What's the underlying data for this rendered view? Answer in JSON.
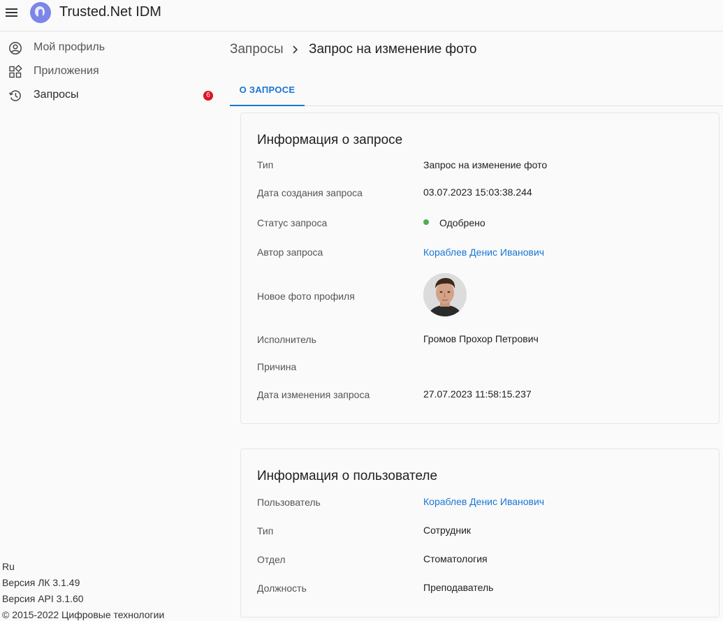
{
  "app": {
    "title": "Trusted.Net IDM"
  },
  "sidebar": {
    "items": [
      {
        "label": "Мой профиль",
        "icon": "account-circle-icon"
      },
      {
        "label": "Приложения",
        "icon": "apps-grid-icon"
      },
      {
        "label": "Запросы",
        "icon": "history-icon",
        "badge": "6"
      }
    ]
  },
  "footer": {
    "language": "Ru",
    "version_lk": "Версия ЛК 3.1.49",
    "version_api": "Версия API 3.1.60",
    "copyright": "© 2015-2022 Цифровые технологии"
  },
  "breadcrumb": {
    "root": "Запросы",
    "current": "Запрос на изменение фото"
  },
  "tabs": [
    {
      "label": "О ЗАПРОСЕ",
      "active": true
    }
  ],
  "request_info": {
    "title": "Информация о запросе",
    "rows": [
      {
        "label": "Тип",
        "value": "Запрос на изменение фото"
      },
      {
        "label": "Дата создания запроса",
        "value": "03.07.2023 15:03:38.244"
      },
      {
        "label": "Статус запроса",
        "value": "Одобрено",
        "status_color": "#4caf50"
      },
      {
        "label": "Автор запроса",
        "value": "Кораблев Денис Иванович"
      },
      {
        "label": "Новое фото профиля",
        "value": ""
      },
      {
        "label": "Исполнитель",
        "value": "Громов Прохор Петрович"
      },
      {
        "label": "Причина",
        "value": ""
      },
      {
        "label": "Дата изменения запроса",
        "value": "27.07.2023 11:58:15.237"
      }
    ]
  },
  "user_info": {
    "title": "Информация о пользователе",
    "rows": [
      {
        "label": "Пользователь",
        "value": "Кораблев Денис Иванович"
      },
      {
        "label": "Тип",
        "value": "Сотрудник"
      },
      {
        "label": "Отдел",
        "value": "Стоматология"
      },
      {
        "label": "Должность",
        "value": "Преподаватель"
      }
    ]
  },
  "colors": {
    "accent": "#1976d2",
    "badge": "#e0141e",
    "approved": "#4caf50"
  }
}
